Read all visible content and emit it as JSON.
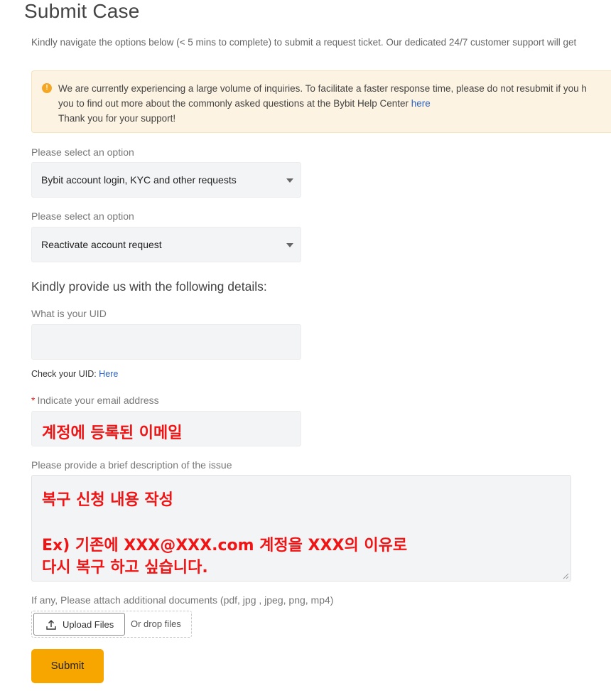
{
  "page": {
    "title": "Submit Case",
    "intro": "Kindly navigate the options below (< 5 mins to complete) to submit a request ticket. Our dedicated 24/7 customer support will get"
  },
  "notice": {
    "icon": "info-icon",
    "line1": "We are currently experiencing a large volume of inquiries. To facilitate a faster response time, please do not resubmit if you h",
    "line2_prefix": "you to find out more about the commonly asked questions at the Bybit Help Center ",
    "line2_link": "here",
    "line3": "Thank you for your support!"
  },
  "form": {
    "category": {
      "label": "Please select an option",
      "value": "Bybit account login, KYC and other requests"
    },
    "subcategory": {
      "label": "Please select an option",
      "value": "Reactivate account request"
    },
    "details_heading": "Kindly provide us with the following details:",
    "uid": {
      "label": "What is your UID",
      "value": "",
      "help_prefix": "Check your UID: ",
      "help_link": "Here"
    },
    "email": {
      "required_mark": "*",
      "label": "Indicate your email address",
      "value": "계정에 등록된 이메일"
    },
    "description": {
      "label": "Please provide a brief description of the issue",
      "line1": "복구 신청 내용 작성",
      "line2": "Ex) 기존에 XXX@XXX.com 계정을 XXX의 이유로",
      "line3": "다시 복구 하고 싶습니다."
    },
    "attachments": {
      "label": "If any, Please attach additional documents (pdf, jpg , jpeg, png, mp4)",
      "upload_label": "Upload Files",
      "drop_label": "Or drop files"
    },
    "submit_label": "Submit"
  },
  "colors": {
    "accent": "#f7a600",
    "notice_bg": "#fdf3e2",
    "link": "#2b62c4",
    "annotation_red": "#f01414"
  }
}
